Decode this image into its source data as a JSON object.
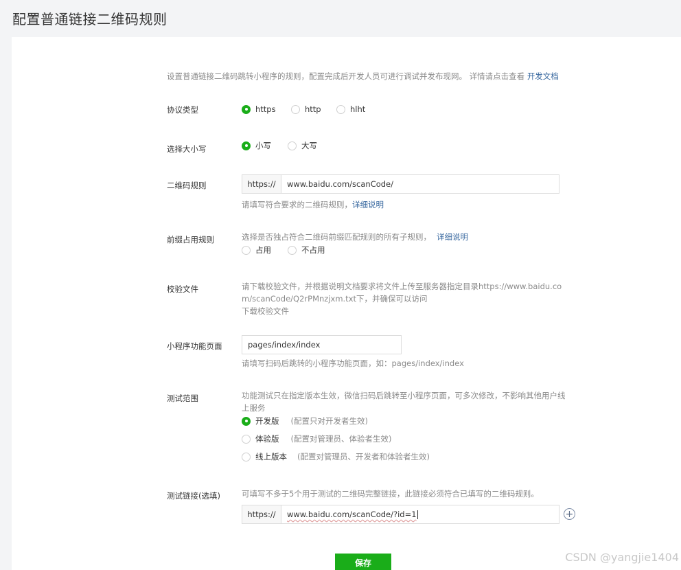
{
  "page_title": "配置普通链接二维码规则",
  "intro": {
    "text": "设置普通链接二维码跳转小程序的规则，配置完成后开发人员可进行调试并发布现网。 详情请点击查看 ",
    "link": "开发文档"
  },
  "protocol": {
    "label": "协议类型",
    "options": [
      {
        "label": "https",
        "checked": true
      },
      {
        "label": "http",
        "checked": false
      },
      {
        "label": "hlht",
        "checked": false
      }
    ]
  },
  "case": {
    "label": "选择大小写",
    "options": [
      {
        "label": "小写",
        "checked": true
      },
      {
        "label": "大写",
        "checked": false
      }
    ]
  },
  "qr_rule": {
    "label": "二维码规则",
    "prefix": "https://",
    "value": "www.baidu.com/scanCode/",
    "hint": "请填写符合要求的二维码规则，",
    "hint_link": "详细说明"
  },
  "prefix_rule": {
    "label": "前缀占用规则",
    "hint": "选择是否独占符合二维码前缀匹配规则的所有子规则，",
    "hint_link": "详细说明",
    "options": [
      {
        "label": "占用",
        "checked": false
      },
      {
        "label": "不占用",
        "checked": false
      }
    ]
  },
  "verify_file": {
    "label": "校验文件",
    "line1": "请下载校验文件，并根据说明文档要求将文件上传至服务器指定目录https://www.baidu.co",
    "line2": "m/scanCode/Q2rPMnzjxm.txt下，并确保可以访问",
    "download_link": "下载校验文件"
  },
  "mini_page": {
    "label": "小程序功能页面",
    "value": "pages/index/index",
    "hint": "请填写扫码后跳转的小程序功能页面，如：pages/index/index"
  },
  "test_scope": {
    "label": "测试范围",
    "line1": "功能测试只在指定版本生效，微信扫码后跳转至小程序页面，可多次修改，不影响其他用户线",
    "line2": "上服务",
    "options": [
      {
        "label": "开发版",
        "note": "(配置只对开发者生效)",
        "checked": true
      },
      {
        "label": "体验版",
        "note": "(配置对管理员、体验者生效)",
        "checked": false
      },
      {
        "label": "线上版本",
        "note": "(配置对管理员、开发者和体验者生效)",
        "checked": false
      }
    ]
  },
  "test_link": {
    "label": "测试链接(选填)",
    "hint": "可填写不多于5个用于测试的二维码完整链接，此链接必须符合已填写的二维码规则。",
    "prefix": "https://",
    "value": "www.baidu.com/scanCode/?id=1"
  },
  "save_label": "保存",
  "watermark": "CSDN @yangjie1404",
  "colors": {
    "accent": "#1aad19",
    "link": "#35669e",
    "hint": "#8a8a8a",
    "background": "#f3f4f6"
  }
}
